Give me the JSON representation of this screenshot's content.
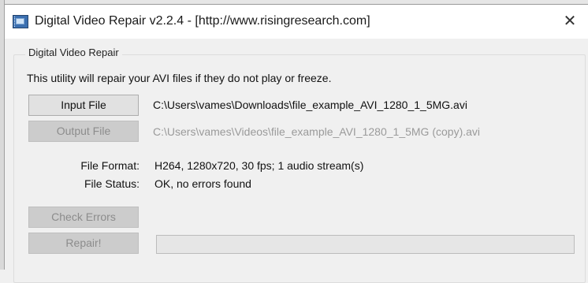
{
  "window": {
    "title": "Digital Video Repair v2.2.4 - [http://www.risingresearch.com]",
    "close_glyph": "✕",
    "icon": "app-film-icon"
  },
  "group": {
    "label": "Digital Video Repair",
    "description": "This utility will repair your AVI files if they do not play or freeze."
  },
  "input": {
    "button_label": "Input File",
    "path": "C:\\Users\\vames\\Downloads\\file_example_AVI_1280_1_5MG.avi"
  },
  "output": {
    "button_label": "Output File",
    "path": "C:\\Users\\vames\\Videos\\file_example_AVI_1280_1_5MG (copy).avi",
    "enabled": false
  },
  "info": {
    "format_label": "File Format:",
    "format_value": "H264, 1280x720, 30 fps; 1 audio stream(s)",
    "status_label": "File Status:",
    "status_value": "OK, no errors found"
  },
  "actions": {
    "check_label": "Check Errors",
    "repair_label": "Repair!",
    "enabled": false
  },
  "progress": {
    "value": 0
  }
}
